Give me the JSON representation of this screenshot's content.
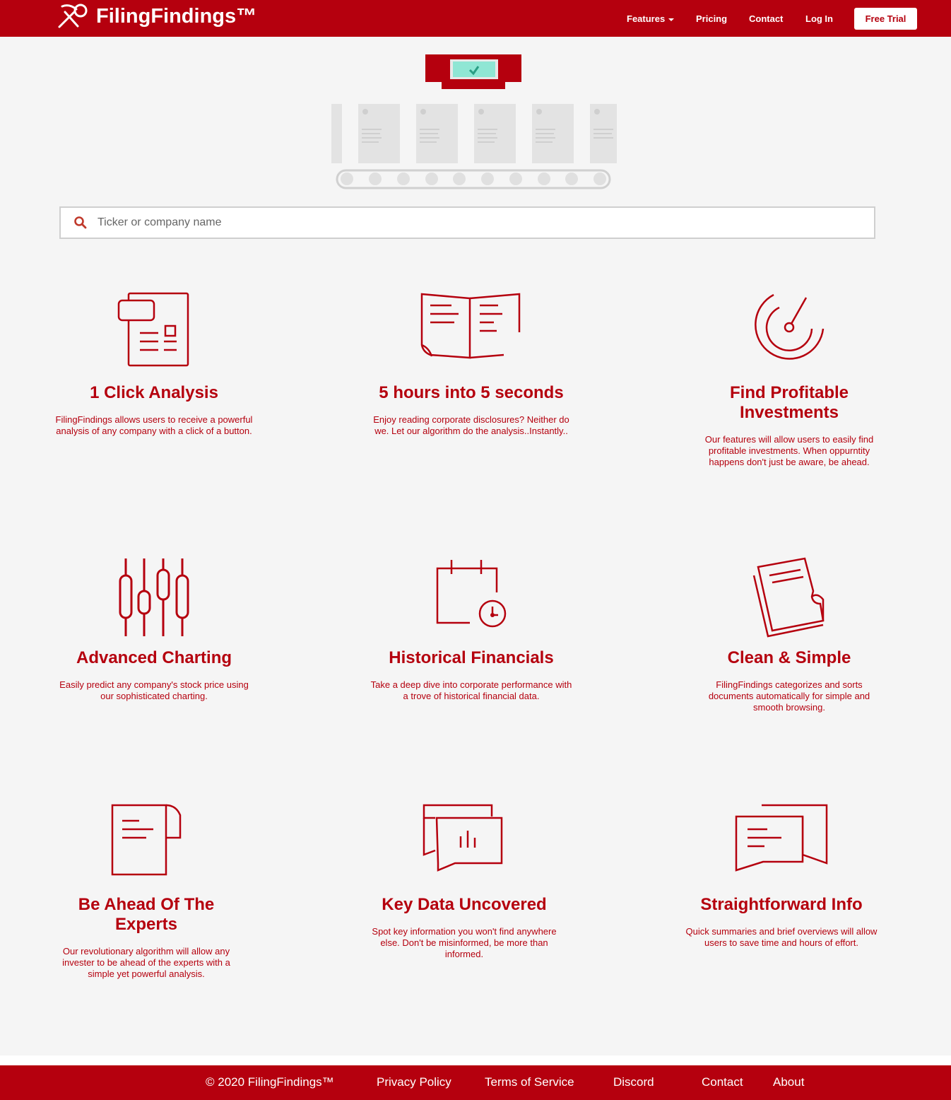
{
  "navbar": {
    "brand": "FilingFindings™",
    "features": "Features",
    "pricing": "Pricing",
    "contact": "Contact",
    "login": "Log In",
    "free_trial": "Free Trial"
  },
  "search": {
    "placeholder": "Ticker or company name"
  },
  "features": [
    {
      "title": "1 Click Analysis",
      "desc": "FilingFindings allows users to receive a powerful analysis of any company with a click of a button.",
      "icon": "document-analysis-icon"
    },
    {
      "title": "5 hours into 5 seconds",
      "desc": "Enjoy reading corporate disclosures? Neither do we. Let our algorithm do the analysis..Instantly..",
      "icon": "open-book-icon"
    },
    {
      "title": "Find Profitable Investments",
      "desc": "Our features will allow users to easily find profitable investments. When oppurntity happens don't just be aware, be ahead.",
      "icon": "radar-gauge-icon"
    },
    {
      "title": "Advanced Charting",
      "desc": "Easily predict any company's stock price using our sophisticated charting.",
      "icon": "candlestick-chart-icon"
    },
    {
      "title": "Historical Financials",
      "desc": "Take a deep dive into corporate performance with a trove of historical financial data.",
      "icon": "calendar-clock-icon"
    },
    {
      "title": "Clean & Simple",
      "desc": "FilingFindings categorizes and sorts documents automatically for simple and smooth browsing.",
      "icon": "stacked-documents-icon"
    },
    {
      "title": "Be Ahead Of The Experts",
      "desc": "Our revolutionary algorithm will allow any invester to be ahead of the experts with a simple yet powerful analysis.",
      "icon": "curled-document-icon"
    },
    {
      "title": "Key Data Uncovered",
      "desc": "Spot key information you won't find anywhere else. Don't be misinformed, be more than informed.",
      "icon": "chat-chart-icon"
    },
    {
      "title": "Straightforward Info",
      "desc": "Quick summaries and brief overviews will allow users to save time and hours of effort.",
      "icon": "chat-bubbles-icon"
    }
  ],
  "footer": {
    "copyright": "© 2020 FilingFindings™",
    "privacy": "Privacy Policy",
    "terms": "Terms of Service",
    "discord": "Discord",
    "contact": "Contact",
    "about": "About"
  },
  "colors": {
    "brand_red": "#b5000e",
    "background": "#f5f5f5",
    "hero_check_bg": "#8fe6d4"
  }
}
